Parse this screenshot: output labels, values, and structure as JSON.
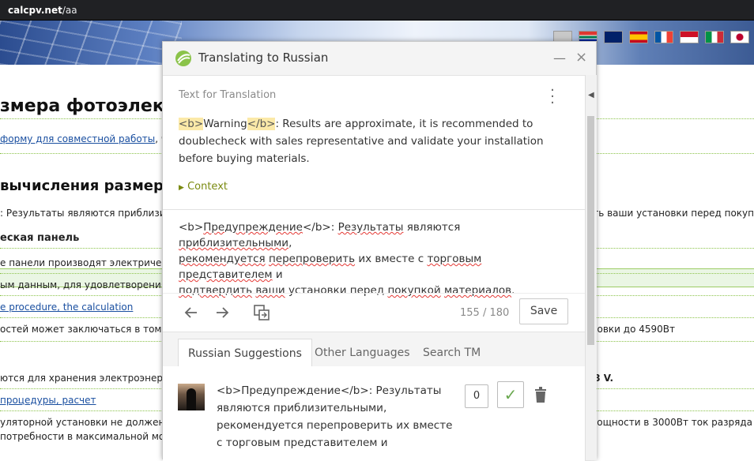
{
  "browser": {
    "url_host": "calcpv.net",
    "url_path": "/aa"
  },
  "page": {
    "h1": "змера фотоэлек",
    "link1_a": "форму для совместной работы",
    "link1_b": ", что",
    "h2": "вычисления размера",
    "row_highlight_left": ": Результаты являются приблизите",
    "row_highlight_right": "дить ваши установки перед покуп",
    "bold1": "еская панель",
    "t1": "е панели производят электричест",
    "t2": "ым данным, для удовлетворения",
    "link2": "e procedure, the calculation",
    "t3": "остей может заключаться в том, чт",
    "t3_right": "новки до 4590Вт",
    "t4": "ются для хранения электроэнерги",
    "t4_right": "8 V.",
    "link3": "процедуры, расчет",
    "t5": "уляторной установки не должен п",
    "t5_right": "мощности в 3000Вт ток разряда",
    "t6": "потребности в максимальной мощ"
  },
  "dialog": {
    "title": "Translating to Russian",
    "minimize_icon": "minimize-icon",
    "close_icon": "close-icon",
    "source_label": "Text for Translation",
    "source_tag_open": "<b>",
    "source_word": "Warning",
    "source_tag_close": "</b>",
    "source_rest": ": Results are approximate, it is recommended to doublecheck with sales representative and validate your installation before buying materials.",
    "context_label": "Context",
    "target": {
      "p1": "<b>",
      "w1": "Предупреждение",
      "p2": "</b>: ",
      "w2": "Результаты",
      "p3": " являются ",
      "w3": "приблизительными",
      "p4": ",",
      "w4": "рекомендуется",
      "p5": " ",
      "w5": "перепроверить",
      "p6": " их вместе с ",
      "w6": "торговым",
      "p7": " ",
      "w7": "представителем",
      "p8": " и ",
      "w8": "подтвердить",
      "p9": " ",
      "w9": "ваши",
      "p10": " установки перед ",
      "w10": "покупкой",
      "p11": " ",
      "w11": "материалов",
      "p12": "."
    },
    "counter": "155 / 180",
    "save_label": "Save",
    "tabs": [
      "Russian Suggestions",
      "Other Languages",
      "Search TM"
    ],
    "suggestion": {
      "text": "<b>Предупреждение</b>: Результаты являются приблизительными, рекомендуется перепроверить их вместе с торговым представителем и",
      "score": "0"
    }
  },
  "colors": {
    "accent_green": "#7a8a10",
    "tag_bg": "#fbe9a8",
    "approve": "#6aa84f"
  }
}
